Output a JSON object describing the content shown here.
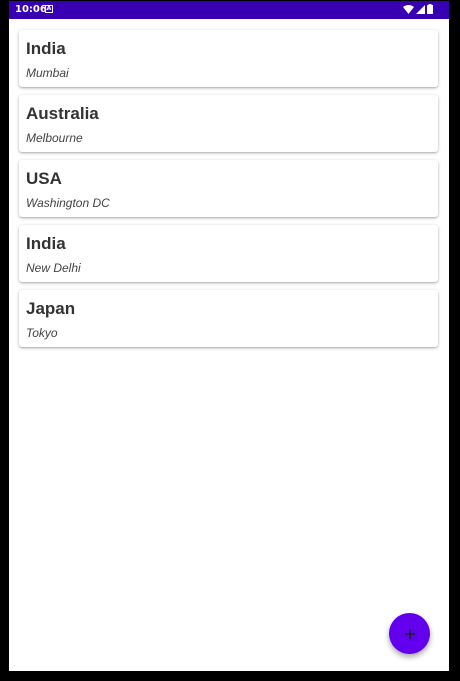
{
  "status_bar": {
    "time": "10:06",
    "notification_icon": "app-notification-icon",
    "wifi_icon": "wifi-icon",
    "signal_icon": "cell-signal-icon",
    "battery_icon": "battery-icon",
    "background_color": "#3700b3"
  },
  "locations": [
    {
      "country": "India",
      "city": "Mumbai"
    },
    {
      "country": "Australia",
      "city": "Melbourne"
    },
    {
      "country": "USA",
      "city": "Washington DC"
    },
    {
      "country": "India",
      "city": "New Delhi"
    },
    {
      "country": "Japan",
      "city": "Tokyo"
    }
  ],
  "fab": {
    "icon": "plus-icon",
    "label": "+",
    "color": "#6200ee"
  }
}
